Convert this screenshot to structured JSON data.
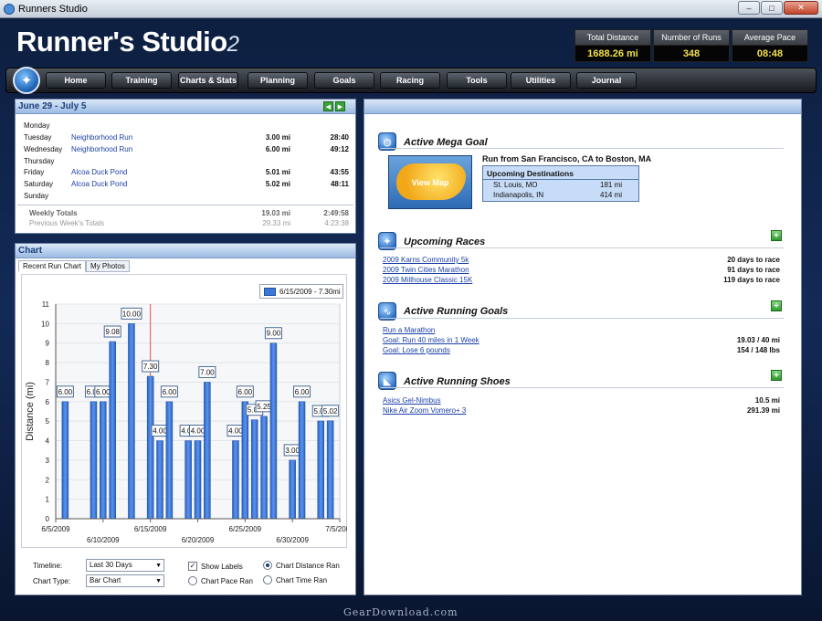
{
  "window": {
    "title": "Runners Studio",
    "controls": [
      "–",
      "□",
      "✕"
    ]
  },
  "logo": {
    "name": "Runner's Studio",
    "version": "2"
  },
  "stats": [
    {
      "label": "Total Distance",
      "value": "1688.26 mi"
    },
    {
      "label": "Number of Runs",
      "value": "348"
    },
    {
      "label": "Average Pace",
      "value": "08:48"
    }
  ],
  "nav": [
    "Home",
    "Training",
    "Charts & Stats",
    "Planning",
    "Goals",
    "Racing",
    "Tools",
    "Utilities",
    "Journal"
  ],
  "week": {
    "title": "June 29 - July 5",
    "days": [
      {
        "day": "Monday",
        "run": "",
        "dist": "",
        "time": ""
      },
      {
        "day": "Tuesday",
        "run": "Neighborhood Run",
        "dist": "3.00 mi",
        "time": "28:40"
      },
      {
        "day": "Wednesday",
        "run": "Neighborhood Run",
        "dist": "6.00 mi",
        "time": "49:12"
      },
      {
        "day": "Thursday",
        "run": "",
        "dist": "",
        "time": ""
      },
      {
        "day": "Friday",
        "run": "Alcoa Duck Pond",
        "dist": "5.01 mi",
        "time": "43:55"
      },
      {
        "day": "Saturday",
        "run": "Alcoa Duck Pond",
        "dist": "5.02 mi",
        "time": "48:11"
      },
      {
        "day": "Sunday",
        "run": "",
        "dist": "",
        "time": ""
      }
    ],
    "totals": {
      "label": "Weekly Totals",
      "dist": "19.03 mi",
      "time": "2:49:58"
    },
    "previous": {
      "label": "Previous Week's Totals",
      "dist": "29.33 mi",
      "time": "4:23:38"
    }
  },
  "chart_panel": {
    "title": "Chart",
    "tabs": [
      "Recent Run Chart",
      "My Photos"
    ],
    "controls": {
      "timeline_label": "Timeline:",
      "timeline_value": "Last 30 Days",
      "type_label": "Chart Type:",
      "type_value": "Bar Chart",
      "show_labels": "Show Labels",
      "chart_pace": "Chart Pace Ran",
      "chart_distance": "Chart Distance Ran",
      "chart_time": "Chart Time Ran"
    }
  },
  "chart_data": {
    "type": "bar",
    "ylabel": "Distance (mi)",
    "ylim": [
      0,
      11
    ],
    "yticks": [
      0,
      1,
      2,
      3,
      4,
      5,
      6,
      7,
      8,
      9,
      10,
      11
    ],
    "xticks": [
      "6/5/2009",
      "6/10/2009",
      "6/15/2009",
      "6/20/2009",
      "6/25/2009",
      "6/30/2009",
      "7/5/2009"
    ],
    "x_range": [
      "2009-06-05",
      "2009-07-05"
    ],
    "legend": "6/15/2009 - 7.30mi",
    "highlight_date": "2009-06-15",
    "grid": true,
    "points": [
      {
        "date": "2009-06-06",
        "value": 6.0,
        "label": "6.00"
      },
      {
        "date": "2009-06-09",
        "value": 6.0,
        "label": "6.00"
      },
      {
        "date": "2009-06-10",
        "value": 6.0,
        "label": "6.00"
      },
      {
        "date": "2009-06-11",
        "value": 9.08,
        "label": "9.08"
      },
      {
        "date": "2009-06-13",
        "value": 10.0,
        "label": "10.00"
      },
      {
        "date": "2009-06-15",
        "value": 7.3,
        "label": "7.30"
      },
      {
        "date": "2009-06-16",
        "value": 4.0,
        "label": "4.00"
      },
      {
        "date": "2009-06-17",
        "value": 6.0,
        "label": "6.00"
      },
      {
        "date": "2009-06-19",
        "value": 4.0,
        "label": "4.00"
      },
      {
        "date": "2009-06-20",
        "value": 4.0,
        "label": "4.00"
      },
      {
        "date": "2009-06-21",
        "value": 7.0,
        "label": "7.00"
      },
      {
        "date": "2009-06-24",
        "value": 4.0,
        "label": "4.00"
      },
      {
        "date": "2009-06-25",
        "value": 6.0,
        "label": "6.00"
      },
      {
        "date": "2009-06-26",
        "value": 5.07,
        "label": "5.07"
      },
      {
        "date": "2009-06-27",
        "value": 5.25,
        "label": "5.25"
      },
      {
        "date": "2009-06-28",
        "value": 9.0,
        "label": "9.00"
      },
      {
        "date": "2009-06-30",
        "value": 3.0,
        "label": "3.00"
      },
      {
        "date": "2009-07-01",
        "value": 6.0,
        "label": "6.00"
      },
      {
        "date": "2009-07-03",
        "value": 5.01,
        "label": "5.01"
      },
      {
        "date": "2009-07-04",
        "value": 5.02,
        "label": "5.02"
      }
    ]
  },
  "mega_goal": {
    "title": "Active Mega Goal",
    "description": "Run from San Francisco, CA to Boston, MA",
    "map_label": "View Map",
    "destinations_title": "Upcoming Destinations",
    "destinations": [
      {
        "city": "St. Louis, MO",
        "dist": "181 mi"
      },
      {
        "city": "Indianapolis, IN",
        "dist": "414 mi"
      }
    ]
  },
  "races": {
    "title": "Upcoming Races",
    "items": [
      {
        "name": "2009 Karns Community 5k",
        "status": "20 days to race"
      },
      {
        "name": "2009 Twin Cities Marathon",
        "status": "91 days to race"
      },
      {
        "name": "2009 Millhouse Classic 15K",
        "status": "119 days to race"
      }
    ]
  },
  "goals": {
    "title": "Active Running Goals",
    "items": [
      {
        "name": "Run a Marathon",
        "status": ""
      },
      {
        "name": "Goal: Run 40 miles in 1 Week",
        "status": "19.03 / 40 mi"
      },
      {
        "name": "Goal: Lose 6 pounds",
        "status": "154 / 148 lbs"
      }
    ]
  },
  "shoes": {
    "title": "Active Running Shoes",
    "items": [
      {
        "name": "Asics Gel-Nimbus",
        "status": "10.5 mi"
      },
      {
        "name": "Nike Air Zoom Vomero+ 3",
        "status": "291.39 mi"
      }
    ]
  },
  "watermark": "GearDownload.com"
}
